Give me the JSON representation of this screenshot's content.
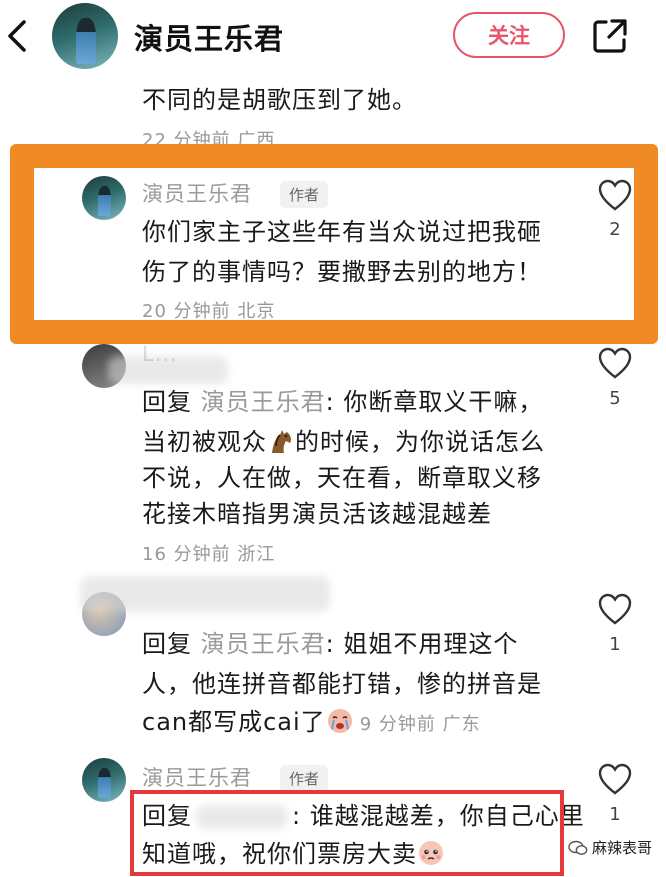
{
  "header": {
    "title": "演员王乐君",
    "follow_label": "关注"
  },
  "top_fragment": {
    "text": "不同的是胡歌压到了她。",
    "meta": "22 分钟前 广西"
  },
  "comments": [
    {
      "author": "演员王乐君",
      "badge": "作者",
      "lines": [
        "你们家主子这些年有当众说过把我砸",
        "伤了的事情吗？要撒野去别的地方！"
      ],
      "meta": "20 分钟前 北京",
      "likes": "2"
    },
    {
      "author": "L...",
      "reply_prefix": "回复 ",
      "mention": "演员王乐君",
      "reply_rest": ": 你断章取义干嘛，",
      "lines": [
        "当初被观众",
        "的时候，为你说话怎么",
        "不说，人在做，天在看，断章取义移",
        "花接木暗指男演员活该越混越差"
      ],
      "meta": "16 分钟前 浙江",
      "likes": "5"
    },
    {
      "reply_prefix": "回复 ",
      "mention": "演员王乐君",
      "reply_rest": ": 姐姐不用理这个",
      "lines": [
        "人，他连拼音都能打错，惨的拼音是",
        "can都写成cai了",
        "9 分钟前 广东"
      ],
      "likes": "1"
    },
    {
      "author": "演员王乐君",
      "badge": "作者",
      "reply_prefix": "回复",
      "reply_rest": ": 谁越混越差，你自己心里",
      "lines": [
        "知道哦，祝你们票房大卖"
      ],
      "likes": "1"
    }
  ],
  "watermark": "麻辣表哥",
  "colors": {
    "follow": "#e8546a",
    "highlight": "#f08a25",
    "red_box": "#e23a3a"
  }
}
